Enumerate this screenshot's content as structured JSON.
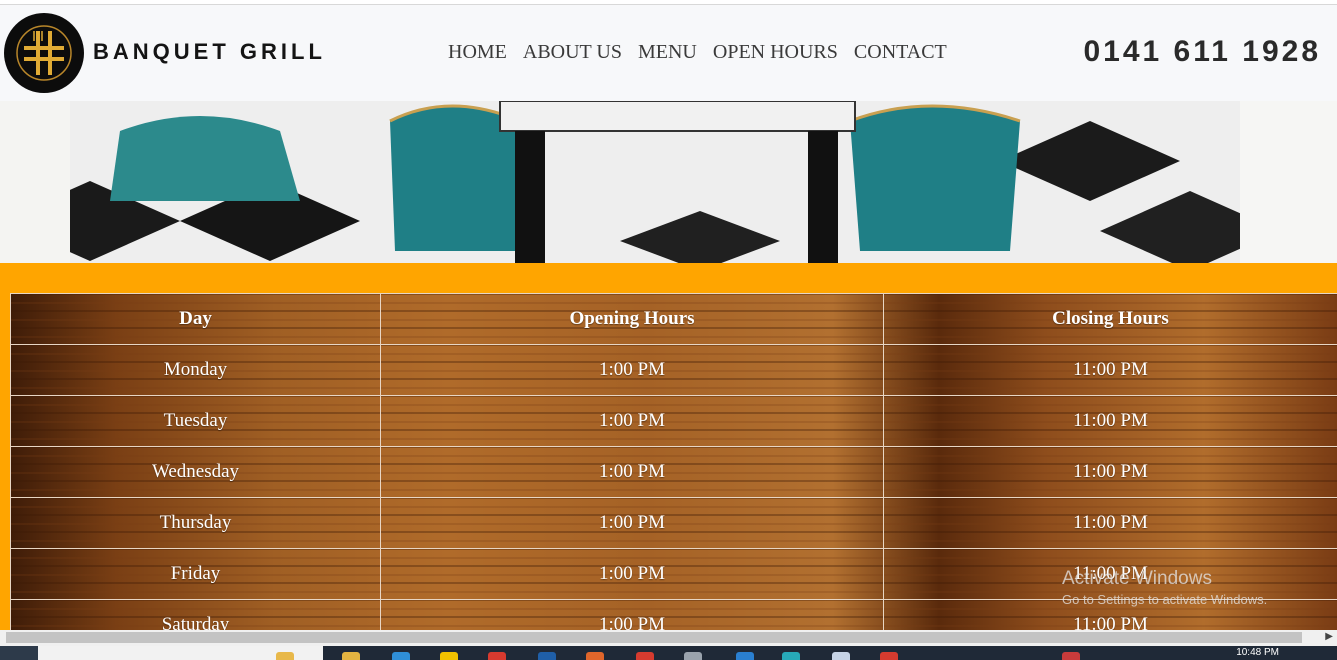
{
  "site": {
    "brand": "BANQUET GRILL",
    "phone": "0141 611 1928",
    "nav": [
      "HOME",
      "ABOUT US",
      "MENU",
      "OPEN HOURS",
      "CONTACT"
    ]
  },
  "hours_table": {
    "headers": [
      "Day",
      "Opening Hours",
      "Closing Hours"
    ],
    "rows": [
      [
        "Monday",
        "1:00 PM",
        "11:00 PM"
      ],
      [
        "Tuesday",
        "1:00 PM",
        "11:00 PM"
      ],
      [
        "Wednesday",
        "1:00 PM",
        "11:00 PM"
      ],
      [
        "Thursday",
        "1:00 PM",
        "11:00 PM"
      ],
      [
        "Friday",
        "1:00 PM",
        "11:00 PM"
      ],
      [
        "Saturday",
        "1:00 PM",
        "11:00 PM"
      ]
    ]
  },
  "os": {
    "activation_title": "Activate Windows",
    "activation_sub": "Go to Settings to activate Windows.",
    "clock": "10:48 PM"
  },
  "colors": {
    "accent_orange": "#ffa500",
    "header_bg": "#f7f8fa",
    "logo_gold": "#d8a431"
  },
  "icons": {
    "logo": "fork-knife-hash-logo-icon",
    "scroll_right": "chevron-right-icon"
  }
}
